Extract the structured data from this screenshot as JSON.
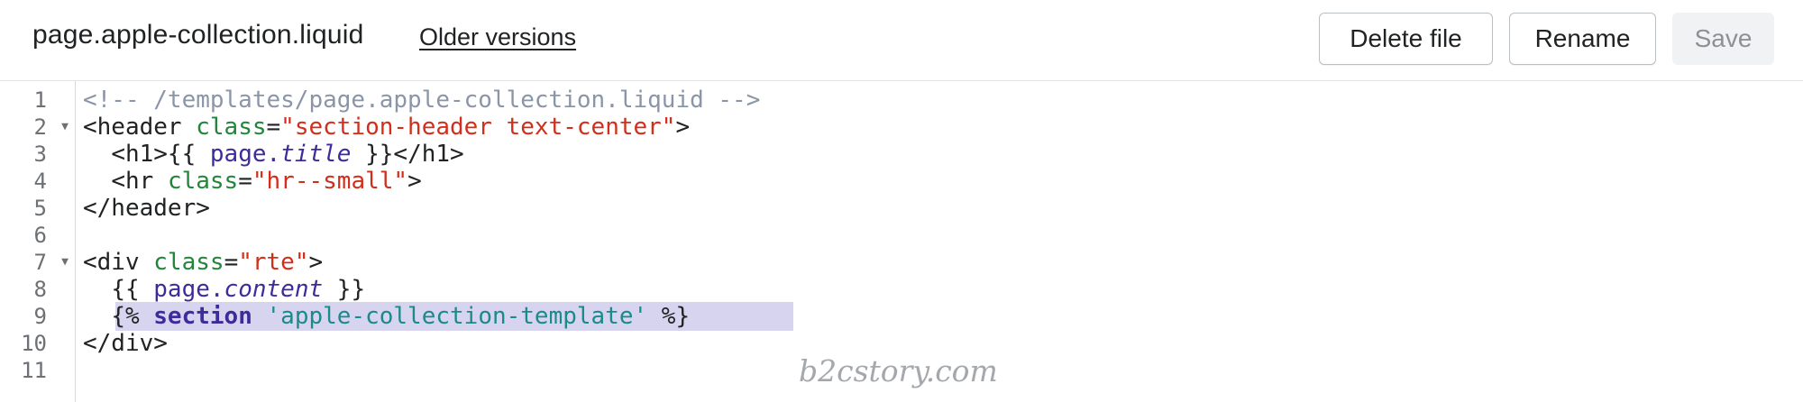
{
  "header": {
    "file_title": "page.apple-collection.liquid",
    "older_versions_label": "Older versions",
    "buttons": {
      "delete_label": "Delete file",
      "rename_label": "Rename",
      "save_label": "Save"
    }
  },
  "editor": {
    "line_numbers": [
      "1",
      "2",
      "3",
      "4",
      "5",
      "6",
      "7",
      "8",
      "9",
      "10",
      "11"
    ],
    "lines": {
      "l1": {
        "comment": "<!-- /templates/page.apple-collection.liquid -->"
      },
      "l2": {
        "tag_open": "<header ",
        "attr": "class",
        "eq": "=",
        "value": "\"section-header text-center\"",
        "tag_close": ">"
      },
      "l3": {
        "indent": "  ",
        "tag_open": "<h1>{{ ",
        "object": "page.",
        "property": "title",
        "tag_close": " }}</h1>"
      },
      "l4": {
        "indent": "  ",
        "tag_open": "<hr ",
        "attr": "class",
        "eq": "=",
        "value": "\"hr--small\"",
        "tag_close": ">"
      },
      "l5": {
        "tag": "</header>"
      },
      "l7": {
        "tag_open": "<div ",
        "attr": "class",
        "eq": "=",
        "value": "\"rte\"",
        "tag_close": ">"
      },
      "l8": {
        "indent": "  ",
        "open": "{{ ",
        "object": "page.",
        "property": "content",
        "close": " }}"
      },
      "l9": {
        "indent": "  ",
        "open": "{% ",
        "keyword": "section",
        "space": " ",
        "string": "'apple-collection-template'",
        "close": " %}"
      },
      "l10": {
        "tag": "</div>"
      }
    },
    "folded_marker": "▼",
    "highlight_color": "#d7d4f0"
  },
  "watermark": "b2cstory.com",
  "colors": {
    "comment": "#8a96a8",
    "attribute": "#22863a",
    "string": "#d22e1a",
    "liquid_object": "#3f2a9b",
    "liquid_string": "#1a8a8a"
  }
}
